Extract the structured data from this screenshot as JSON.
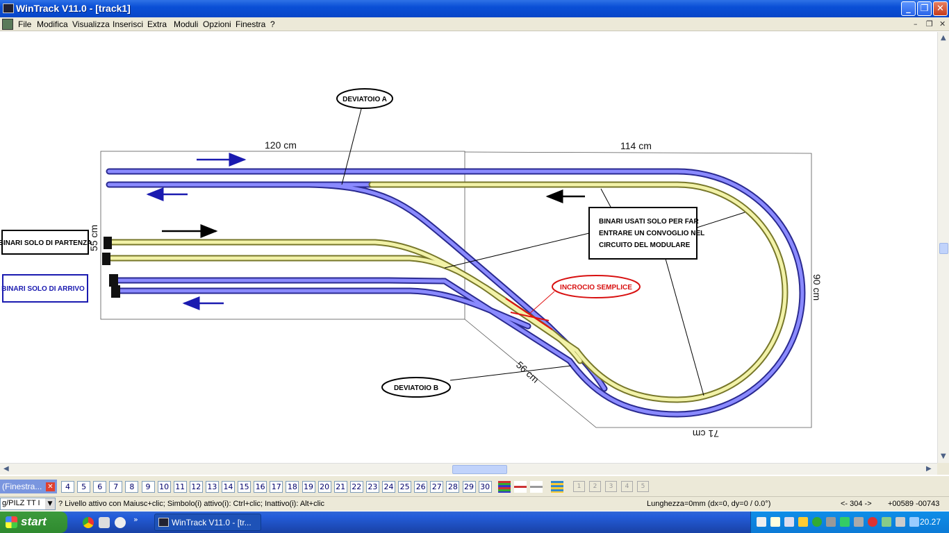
{
  "window": {
    "title": "WinTrack  V11.0 - [track1]"
  },
  "menu": [
    "File",
    "Modifica",
    "Visualizza",
    "Inserisci",
    "Extra",
    "Moduli",
    "Opzioni",
    "Finestra",
    "?"
  ],
  "drawing": {
    "dimensions": {
      "top_left": "120 cm",
      "top_right": "114 cm",
      "left": "55 cm",
      "right": "90 cm",
      "bottom": "71 cm",
      "diagonal": "56 cm"
    },
    "labels": {
      "deviatoio_a": "DEVIATOIO A",
      "deviatoio_b": "DEVIATOIO B",
      "incrocio": "INCROCIO SEMPLICE",
      "binari_partenza": "BINARI SOLO DI PARTENZA",
      "binari_arrivo": "BINARI SOLO DI ARRIVO",
      "note_line1": "BINARI USATI SOLO PER FAR",
      "note_line2": "ENTRARE UN CONVOGLIO NEL",
      "note_line3": "CIRCUITO DEL MODULARE"
    },
    "colors": {
      "blue_track": "#4a4ad8",
      "yellow_track": "#e8e89a",
      "red_label": "#d81010",
      "blue_label": "#1a1ab0"
    }
  },
  "toolbar": {
    "mdi_tab": "(Finestra...",
    "layers": [
      "4",
      "5",
      "6",
      "7",
      "8",
      "9",
      "10",
      "11",
      "12",
      "13",
      "14",
      "15",
      "16",
      "17",
      "18",
      "19",
      "20",
      "21",
      "22",
      "23",
      "24",
      "25",
      "26",
      "27",
      "28",
      "29",
      "30"
    ],
    "boxes": [
      "1",
      "2",
      "3",
      "4",
      "5"
    ]
  },
  "status": {
    "combo_value": "g/PILZ TT I",
    "hint": "? Livello attivo con Maiusc+clic; Simbolo(i) attivo(i): Ctrl+clic; Inattivo(i): Alt+clic",
    "length": "Lunghezza=0mm (dx=0, dy=0 / 0.0°)",
    "scale": "<- 304 ->",
    "coords": "+00589 -00743"
  },
  "taskbar": {
    "start": "start",
    "task": "WinTrack  V11.0 - [tr...",
    "clock": "20.27"
  }
}
